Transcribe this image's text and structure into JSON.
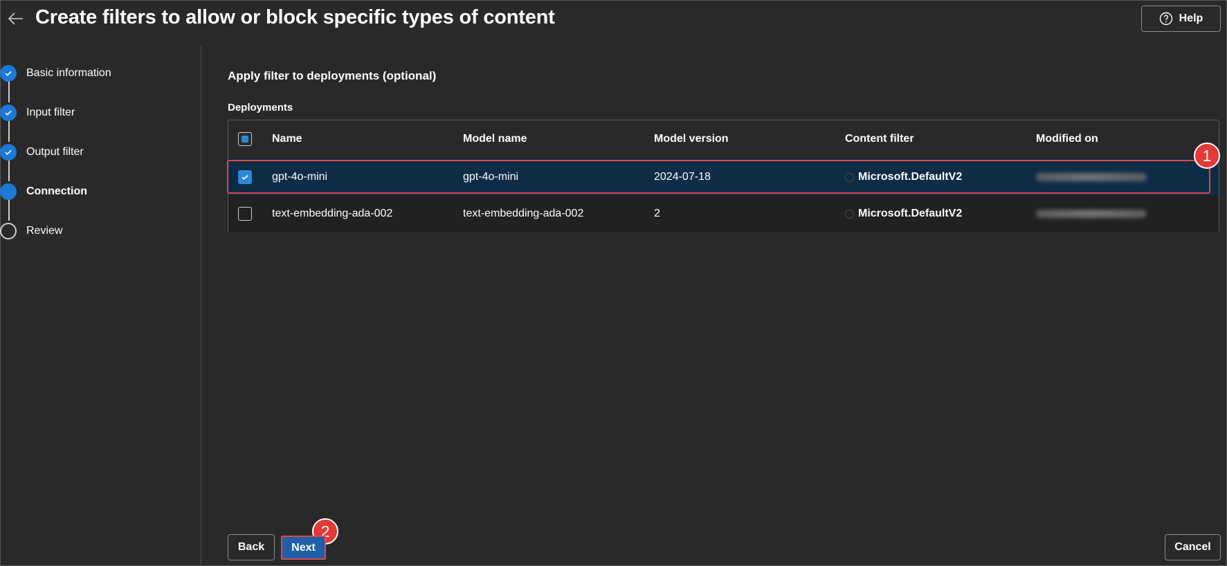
{
  "header": {
    "title": "Create filters to allow or block specific types of content",
    "help_label": "Help"
  },
  "stepper": {
    "steps": [
      {
        "label": "Basic information",
        "state": "done"
      },
      {
        "label": "Input filter",
        "state": "done"
      },
      {
        "label": "Output filter",
        "state": "done"
      },
      {
        "label": "Connection",
        "state": "current"
      },
      {
        "label": "Review",
        "state": "todo"
      }
    ]
  },
  "main": {
    "section_title": "Apply filter to deployments (optional)",
    "deployments_label": "Deployments",
    "columns": [
      "Name",
      "Model name",
      "Model version",
      "Content filter",
      "Modified on"
    ],
    "rows": [
      {
        "name": "gpt-4o-mini",
        "model_name": "gpt-4o-mini",
        "model_version": "2024-07-18",
        "content_filter": "Microsoft.DefaultV2",
        "checked": true
      },
      {
        "name": "text-embedding-ada-002",
        "model_name": "text-embedding-ada-002",
        "model_version": "2",
        "content_filter": "Microsoft.DefaultV2",
        "checked": false
      }
    ]
  },
  "footer": {
    "back_label": "Back",
    "next_label": "Next",
    "cancel_label": "Cancel"
  },
  "annotations": {
    "badge_1": "1",
    "badge_2": "2"
  },
  "colors": {
    "background": "#292929",
    "accent": "#1d79d8",
    "selected_row": "#0f2c46",
    "highlight": "#e04848"
  }
}
